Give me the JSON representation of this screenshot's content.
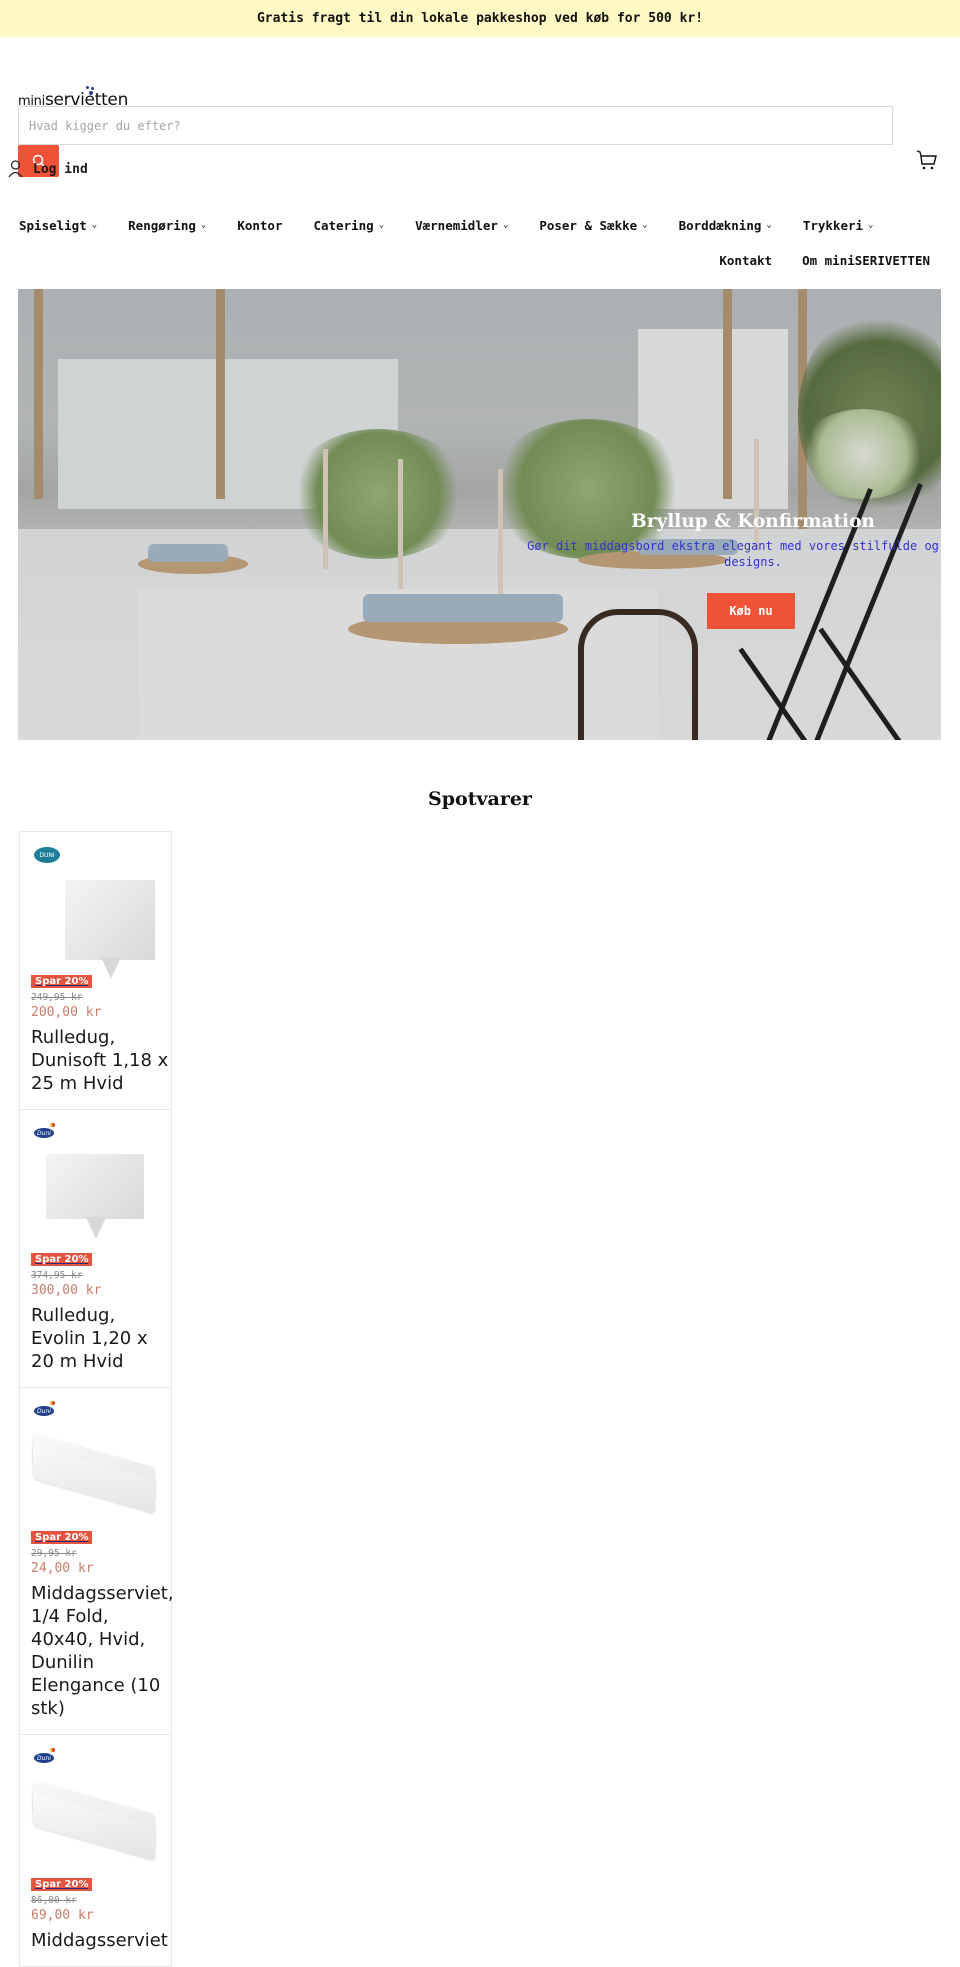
{
  "announcement": {
    "text": "Gratis fragt til din lokale pakkeshop ved køb for 500 kr!"
  },
  "header": {
    "logo_prefix": "mini",
    "logo_main": "serviet",
    "logo_suffix": "ten",
    "search_placeholder": "Hvad kigger du efter?",
    "search_value": "",
    "search_icon": "search-icon",
    "cart_icon": "cart-icon",
    "login_icon": "user-icon",
    "login_label": "Log ind"
  },
  "nav": {
    "primary": [
      {
        "label": "Spiseligt",
        "has_dropdown": true
      },
      {
        "label": "Rengøring",
        "has_dropdown": true
      },
      {
        "label": "Kontor",
        "has_dropdown": false
      },
      {
        "label": "Catering",
        "has_dropdown": true
      },
      {
        "label": "Værnemidler",
        "has_dropdown": true
      },
      {
        "label": "Poser & Sække",
        "has_dropdown": true
      },
      {
        "label": "Borddækning",
        "has_dropdown": true
      },
      {
        "label": "Trykkeri",
        "has_dropdown": true
      }
    ],
    "secondary": [
      {
        "label": "Kontakt"
      },
      {
        "label": "Om miniSERIVETTEN"
      }
    ],
    "chevron": "⌄"
  },
  "hero": {
    "title": "Bryllup & Konfirmation",
    "subtitle_line1": "Gør dit middagsbord ekstra elegant med vores stilfulde og",
    "subtitle_line2": "designs.",
    "cta_label": "Køb nu"
  },
  "featured": {
    "title": "Spotvarer",
    "products": [
      {
        "brand": "DUNI",
        "badge": "Spar 20%",
        "price_old": "249,95 kr",
        "price_new": "200,00 kr",
        "title": "Rulledug, Dunisoft 1,18 x 25 m Hvid"
      },
      {
        "brand": "Duni",
        "badge": "Spar 20%",
        "price_old": "374,95 kr",
        "price_new": "300,00 kr",
        "title": "Rulledug, Evolin 1,20 x 20 m Hvid"
      },
      {
        "brand": "Duni",
        "badge": "Spar 20%",
        "price_old": "29,95 kr",
        "price_new": "24,00 kr",
        "title": "Middagsserviet, 1/4 Fold, 40x40, Hvid, Dunilin Elengance (10 stk)"
      },
      {
        "brand": "Duni",
        "badge": "Spar 20%",
        "price_old": "86,00 kr",
        "price_new": "69,00 kr",
        "title": "Middagsserviet"
      }
    ]
  },
  "colors": {
    "announcement_bg": "#fff9c4",
    "accent": "#ef5238",
    "badge": "#e45440",
    "sale_price": "#c77d6b",
    "hero_subtitle": "#3333cc"
  }
}
